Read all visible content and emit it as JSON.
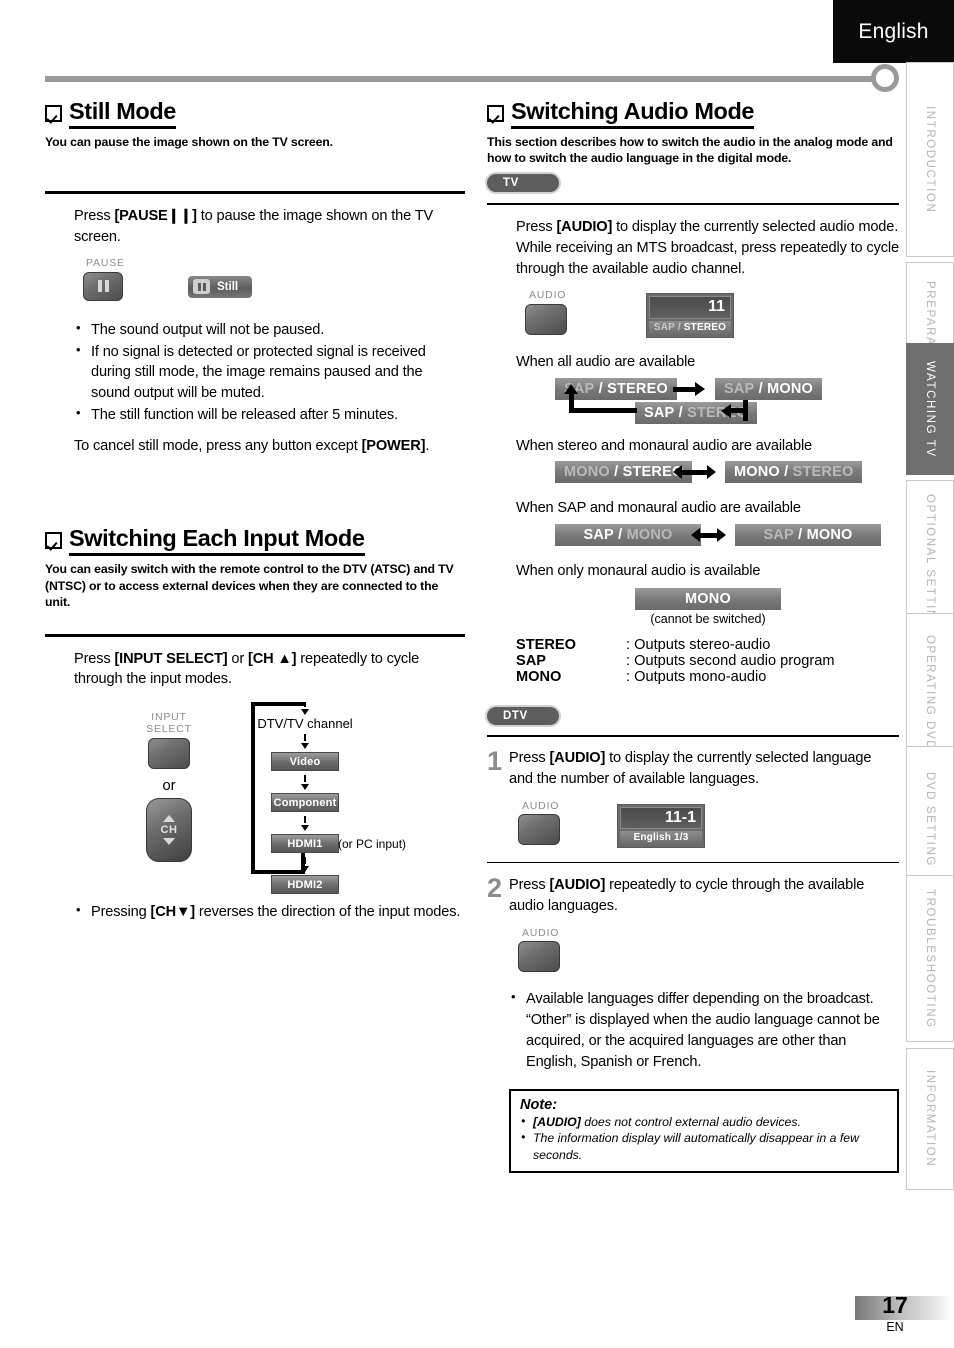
{
  "header": {
    "language_tab": "English"
  },
  "side_tabs": [
    {
      "label": "INTRODUCTION",
      "active": false
    },
    {
      "label": "PREPARATION",
      "active": false
    },
    {
      "label": "WATCHING  TV",
      "active": true
    },
    {
      "label": "OPTIONAL  SETTING",
      "active": false
    },
    {
      "label": "OPERATING  DVD",
      "active": false
    },
    {
      "label": "DVD  SETTING",
      "active": false
    },
    {
      "label": "TROUBLESHOOTING",
      "active": false
    },
    {
      "label": "INFORMATION",
      "active": false
    }
  ],
  "left_column": {
    "still_mode": {
      "title": "Still Mode",
      "subtitle": "You can pause the image shown on the TV screen.",
      "instruction_pre": "Press ",
      "instruction_key": "[PAUSE",
      "instruction_key_suffix": "]",
      "instruction_post": " to pause the image shown on the TV screen.",
      "remote": {
        "button_label": "PAUSE",
        "osd_label": "Still"
      },
      "bullets": [
        "The sound output will not be paused.",
        "If no signal is detected or protected signal is received during still mode, the image remains paused and the sound output will be muted.",
        "The still function will be released after 5 minutes."
      ],
      "cancel_pre": "To cancel still mode, press any button except ",
      "cancel_key": "[POWER]",
      "cancel_post": "."
    },
    "input_mode": {
      "title": "Switching Each Input Mode",
      "subtitle": "You can easily switch with the remote control to the DTV (ATSC) and TV (NTSC) or to access external devices when they are connected to the unit.",
      "instruction_pre": "Press ",
      "instruction_key1": "[INPUT SELECT]",
      "instruction_mid": " or ",
      "instruction_key2": "[CH ▲]",
      "instruction_post": " repeatedly to cycle through the input modes.",
      "remote": {
        "input_select_label_line1": "INPUT",
        "input_select_label_line2": "SELECT",
        "or_label": "or",
        "ch_label": "CH"
      },
      "flow": {
        "first": "DTV/TV channel",
        "items": [
          "Video",
          "Component",
          "HDMI1",
          "HDMI2"
        ],
        "hdmi1_note": "(or PC input)"
      },
      "bullets": [
        "Pressing [CH▼] reverses the direction of the input modes."
      ],
      "bullet_key": "[CH▼]",
      "bullet_pre": "Pressing ",
      "bullet_post": " reverses the direction of the input modes."
    }
  },
  "right_column": {
    "audio_mode": {
      "title": "Switching Audio Mode",
      "subtitle": "This section describes how to switch the audio in the analog mode and how to switch the audio language in the digital mode.",
      "tv_pill": "TV",
      "dtv_pill": "DTV",
      "tv_instruction_pre": "Press ",
      "tv_instruction_key": "[AUDIO]",
      "tv_instruction_post": " to display the currently selected audio mode. While receiving an MTS broadcast, press repeatedly to cycle through the available audio channel.",
      "tv_remote_label": "AUDIO",
      "tv_osd": {
        "number": "11",
        "sub_dim": "SAP /",
        "sub_bright": "STEREO"
      },
      "case1_caption": "When all audio are available",
      "case1_boxes": [
        {
          "dim": "SAP",
          "sep": "/",
          "bright": "STEREO",
          "dim_first": true
        },
        {
          "dim": "SAP",
          "sep": "/",
          "bright": "MONO",
          "dim_first": true
        },
        {
          "bright": "SAP",
          "sep": "/",
          "dim": "STEREO",
          "dim_first": false
        }
      ],
      "case2_caption": "When stereo and monaural audio are available",
      "case2_boxes": [
        {
          "dim": "MONO",
          "sep": "/",
          "bright": "STEREO",
          "dim_first": true
        },
        {
          "bright": "MONO",
          "sep": "/",
          "dim": "STEREO",
          "dim_first": false
        }
      ],
      "case3_caption": "When SAP and monaural audio are available",
      "case3_boxes": [
        {
          "bright": "SAP",
          "sep": "/",
          "dim": "MONO",
          "dim_first": false
        },
        {
          "dim": "SAP",
          "sep": "/",
          "bright": "MONO",
          "dim_first": true
        }
      ],
      "case4_caption": "When only monaural audio is available",
      "case4_box": "MONO",
      "case4_note": "(cannot be switched)",
      "definitions": [
        {
          "term": "STEREO",
          "desc": ": Outputs stereo-audio"
        },
        {
          "term": "SAP",
          "desc": ": Outputs second audio program"
        },
        {
          "term": "MONO",
          "desc": ": Outputs mono-audio"
        }
      ],
      "steps": [
        {
          "number": "1",
          "text_pre": "Press ",
          "key": "[AUDIO]",
          "text_post": " to display the currently selected language and the number of available languages.",
          "remote_label": "AUDIO",
          "osd": {
            "number": "11-1",
            "sub": "English 1/3"
          }
        },
        {
          "number": "2",
          "text_pre": "Press ",
          "key": "[AUDIO]",
          "text_post": " repeatedly to cycle through the available audio languages.",
          "remote_label": "AUDIO",
          "bullets": [
            "Available languages differ depending on the broadcast. “Other” is displayed when the audio language cannot be acquired, or the acquired languages are other than English, Spanish or French."
          ]
        }
      ],
      "note": {
        "title": "Note:",
        "items_pre": [
          "",
          "The information display will automatically disappear in a few seconds."
        ],
        "item1_key": "[AUDIO]",
        "item1_post": " does not control external audio devices.",
        "item2": "The information display will automatically disappear in a few seconds."
      }
    }
  },
  "footer": {
    "page_number": "17",
    "page_lang": "EN"
  }
}
